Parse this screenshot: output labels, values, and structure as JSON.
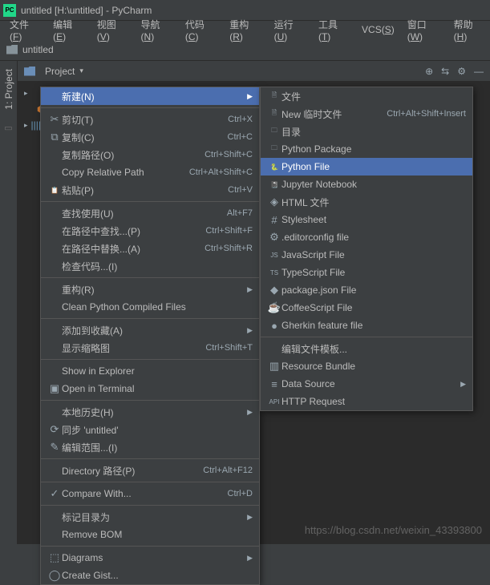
{
  "window": {
    "title": "untitled [H:\\untitled] - PyCharm",
    "app_icon_text": "PC"
  },
  "menubar": [
    "文件(F)",
    "编辑(E)",
    "视图(V)",
    "导航(N)",
    "代码(C)",
    "重构(R)",
    "运行(U)",
    "工具(T)",
    "VCS(S)",
    "窗口(W)",
    "帮助(H)"
  ],
  "breadcrumb": {
    "label": "untitled"
  },
  "sidebar": {
    "tab_label": "1: Project"
  },
  "projectbar": {
    "label": "Project"
  },
  "context_menu": [
    {
      "icon": "",
      "label": "新建(N)",
      "shortcut": "",
      "arrow": true,
      "sel": true
    },
    {
      "sep": true
    },
    {
      "icon": "✂",
      "label": "剪切(T)",
      "shortcut": "Ctrl+X"
    },
    {
      "icon": "⧉",
      "label": "复制(C)",
      "shortcut": "Ctrl+C"
    },
    {
      "icon": "",
      "label": "复制路径(O)",
      "shortcut": "Ctrl+Shift+C"
    },
    {
      "icon": "",
      "label": "Copy Relative Path",
      "shortcut": "Ctrl+Alt+Shift+C"
    },
    {
      "icon": "📋",
      "label": "粘贴(P)",
      "shortcut": "Ctrl+V"
    },
    {
      "sep": true
    },
    {
      "icon": "",
      "label": "查找使用(U)",
      "shortcut": "Alt+F7"
    },
    {
      "icon": "",
      "label": "在路径中查找...(P)",
      "shortcut": "Ctrl+Shift+F"
    },
    {
      "icon": "",
      "label": "在路径中替换...(A)",
      "shortcut": "Ctrl+Shift+R"
    },
    {
      "icon": "",
      "label": "检查代码...(I)",
      "shortcut": ""
    },
    {
      "sep": true
    },
    {
      "icon": "",
      "label": "重构(R)",
      "shortcut": "",
      "arrow": true
    },
    {
      "icon": "",
      "label": "Clean Python Compiled Files",
      "shortcut": ""
    },
    {
      "sep": true
    },
    {
      "icon": "",
      "label": "添加到收藏(A)",
      "shortcut": "",
      "arrow": true
    },
    {
      "icon": "",
      "label": "显示缩略图",
      "shortcut": "Ctrl+Shift+T"
    },
    {
      "sep": true
    },
    {
      "icon": "",
      "label": "Show in Explorer",
      "shortcut": ""
    },
    {
      "icon": "▣",
      "label": "Open in Terminal",
      "shortcut": ""
    },
    {
      "sep": true
    },
    {
      "icon": "",
      "label": "本地历史(H)",
      "shortcut": "",
      "arrow": true
    },
    {
      "icon": "⟳",
      "label": "同步 'untitled'",
      "shortcut": ""
    },
    {
      "icon": "✎",
      "label": "编辑范围...(I)",
      "shortcut": ""
    },
    {
      "sep": true
    },
    {
      "icon": "",
      "label": "Directory 路径(P)",
      "shortcut": "Ctrl+Alt+F12"
    },
    {
      "sep": true
    },
    {
      "icon": "✓",
      "label": "Compare With...",
      "shortcut": "Ctrl+D"
    },
    {
      "sep": true
    },
    {
      "icon": "",
      "label": "标记目录为",
      "shortcut": "",
      "arrow": true
    },
    {
      "icon": "",
      "label": "Remove BOM",
      "shortcut": ""
    },
    {
      "sep": true
    },
    {
      "icon": "⬚",
      "label": "Diagrams",
      "shortcut": "",
      "arrow": true
    },
    {
      "icon": "◯",
      "label": "Create Gist...",
      "shortcut": ""
    }
  ],
  "submenu": [
    {
      "icon": "🗎",
      "cls": "",
      "label": "文件",
      "shortcut": ""
    },
    {
      "icon": "🗎",
      "cls": "",
      "label": "New 临时文件",
      "shortcut": "Ctrl+Alt+Shift+Insert"
    },
    {
      "icon": "🗀",
      "cls": "folder-ico",
      "label": "目录",
      "shortcut": ""
    },
    {
      "icon": "🗀",
      "cls": "folder-ico",
      "label": "Python Package",
      "shortcut": ""
    },
    {
      "icon": "🐍",
      "cls": "py-ico",
      "label": "Python File",
      "shortcut": "",
      "sel": true
    },
    {
      "icon": "📓",
      "cls": "",
      "label": "Jupyter Notebook",
      "shortcut": ""
    },
    {
      "icon": "◈",
      "cls": "html-ico",
      "label": "HTML 文件",
      "shortcut": ""
    },
    {
      "icon": "#",
      "cls": "",
      "label": "Stylesheet",
      "shortcut": ""
    },
    {
      "icon": "⚙",
      "cls": "",
      "label": ".editorconfig file",
      "shortcut": ""
    },
    {
      "icon": "JS",
      "cls": "js-ico",
      "label": "JavaScript File",
      "shortcut": ""
    },
    {
      "icon": "TS",
      "cls": "ts-ico",
      "label": "TypeScript File",
      "shortcut": ""
    },
    {
      "icon": "◆",
      "cls": "json-ico",
      "label": "package.json File",
      "shortcut": ""
    },
    {
      "icon": "☕",
      "cls": "coffee-ico",
      "label": "CoffeeScript File",
      "shortcut": ""
    },
    {
      "icon": "●",
      "cls": "gherkin-ico",
      "label": "Gherkin feature file",
      "shortcut": ""
    },
    {
      "sep": true
    },
    {
      "icon": "",
      "cls": "",
      "label": "编辑文件模板...",
      "shortcut": ""
    },
    {
      "icon": "▥",
      "cls": "",
      "label": "Resource Bundle",
      "shortcut": ""
    },
    {
      "icon": "≡",
      "cls": "db-ico",
      "label": "Data Source",
      "shortcut": "",
      "arrow": true
    },
    {
      "icon": "API",
      "cls": "http-ico",
      "label": "HTTP Request",
      "shortcut": ""
    }
  ],
  "watermark": "https://blog.csdn.net/weixin_43393800"
}
